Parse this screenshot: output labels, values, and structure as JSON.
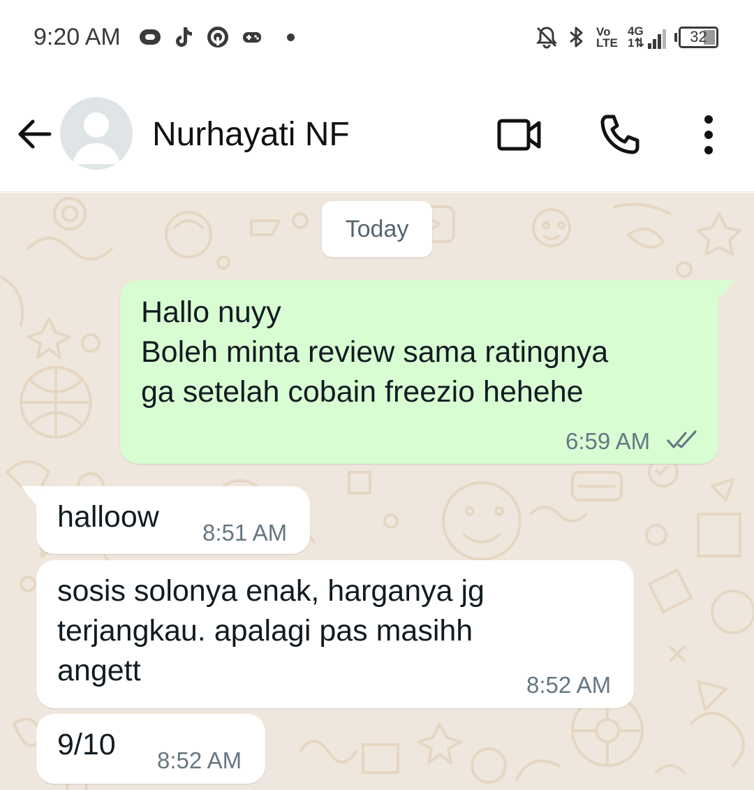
{
  "status_bar": {
    "time": "9:20 AM",
    "volte_line1": "Vo",
    "volte_line2": "LTE",
    "network_line1": "4G",
    "network_line2": "1⇅",
    "battery_level": "32",
    "icons": [
      "message-app-icon",
      "tiktok-icon",
      "shopee-icon",
      "game-controller-icon",
      "notification-dot",
      "bell-muted-icon",
      "bluetooth-icon",
      "signal-icon",
      "battery-icon"
    ]
  },
  "header": {
    "contact_name": "Nurhayati NF",
    "icons": [
      "back-arrow-icon",
      "avatar-placeholder-icon",
      "video-call-icon",
      "phone-icon",
      "more-vertical-icon"
    ]
  },
  "chat": {
    "date_chip": "Today",
    "messages": [
      {
        "direction": "outgoing",
        "text": "Hallo nuyy\nBoleh minta review sama ratingnya\nga setelah cobain freezio hehehe",
        "time": "6:59 AM",
        "status": "read"
      },
      {
        "direction": "incoming",
        "text": "halloow",
        "time": "8:51 AM"
      },
      {
        "direction": "incoming",
        "text": "sosis solonya enak, harganya jg\nterjangkau. apalagi pas masihh\nangett",
        "time": "8:52 AM"
      },
      {
        "direction": "incoming",
        "text": "9/10",
        "time": "8:52 AM"
      }
    ]
  },
  "colors": {
    "chat_background": "#efe7dd",
    "outgoing_bubble": "#d9fdd3",
    "incoming_bubble": "#ffffff",
    "read_ticks": "#667781",
    "wallpaper_doodle": "#e6d6c2"
  }
}
